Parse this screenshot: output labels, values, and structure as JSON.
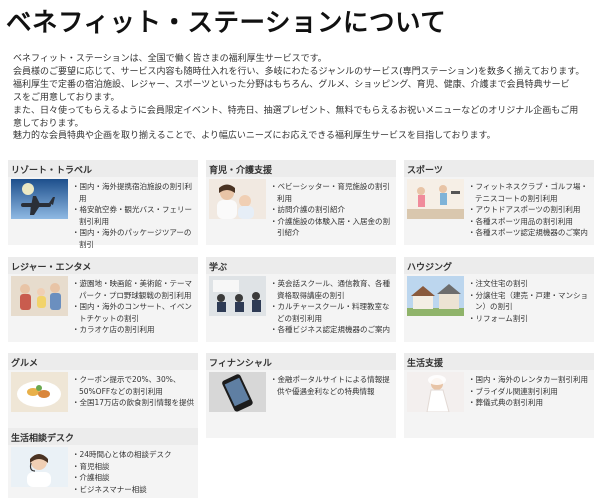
{
  "title": "ベネフィット・ステーションについて",
  "intro_lines": [
    "ベネフィット・ステーションは、全国で働く皆さまの福利厚生サービスです。",
    "会員様のご要望に応じて、サービス内容も随時仕入れを行い、多岐にわたるジャンルのサービス(専門ステーション)を数多く揃えております。",
    "福利厚生で定番の宿泊施設、レジャー、スポーツといった分野はもちろん、グルメ、ショッピング、育児、健康、介護まで会員特典サービ",
    "スをご用意しております。",
    "また、日々使ってもらえるように会員限定イベント、特売日、抽選プレゼント、無料でもらえるお祝いメニューなどのオリジナル企画もご用",
    "意しております。",
    "魅力的な会員特典や企画を取り揃えることで、より幅広いニーズにお応えできる福利厚生サービスを目指しております。"
  ],
  "categories": [
    {
      "heading": "リゾート・トラベル",
      "image": "airplane-photo",
      "items": [
        "国内・海外提携宿泊施設の割引利用",
        "格安航空券・観光バス・フェリー割引利用",
        "国内・海外のパッケージツアーの割引"
      ]
    },
    {
      "heading": "育児・介護支援",
      "image": "mother-child-photo",
      "items": [
        "ベビーシッター・育児施設の割引利用",
        "訪問介護の割引紹介",
        "介護施設の体験入居・入居金の割引紹介"
      ]
    },
    {
      "heading": "スポーツ",
      "image": "fitness-photo",
      "items": [
        "フィットネスクラブ・ゴルフ場・テニスコートの割引利用",
        "アウトドアスポーツの割引利用",
        "各種スポーツ用品の割引利用",
        "各種スポーツ認定規機器のご案内"
      ]
    },
    {
      "heading": "レジャー・エンタメ",
      "image": "family-leisure-photo",
      "items": [
        "遊園地・映画館・美術館・テーマパーク・プロ野球観戦の割引利用",
        "国内・海外のコンサート、イベントチケットの割引",
        "カラオケ店の割引利用"
      ]
    },
    {
      "heading": "学ぶ",
      "image": "classroom-photo",
      "items": [
        "英会話スクール、通信教育、各種資格取得講座の割引",
        "カルチャースクール・料理教室などの割引利用",
        "各種ビジネス認定規機器のご案内"
      ]
    },
    {
      "heading": "ハウジング",
      "image": "houses-photo",
      "items": [
        "注文住宅の割引",
        "分譲住宅（建売・戸建・マンション）の割引",
        "リフォーム割引"
      ]
    },
    {
      "heading": "グルメ",
      "image": "dish-photo",
      "items": [
        "クーポン提示で20%、30%、50%OFFなどの割引利用",
        "全国17万店の飲食割引情報を提供"
      ]
    },
    {
      "heading": "フィナンシャル",
      "image": "smartphone-photo",
      "items": [
        "金融ポータルサイトによる情報提供や優遇金利などの特典情報"
      ]
    },
    {
      "heading": "生活支援",
      "image": "bride-photo",
      "items": [
        "国内・海外のレンタカー割引利用",
        "ブライダル関連割引利用",
        "葬儀式典の割引利用"
      ]
    },
    {
      "heading": "生活相談デスク",
      "image": "operator-photo",
      "items": [
        "24時間心と体の相談デスク",
        "育児相談",
        "介護相談",
        "ビジネスマナー相談"
      ]
    }
  ]
}
